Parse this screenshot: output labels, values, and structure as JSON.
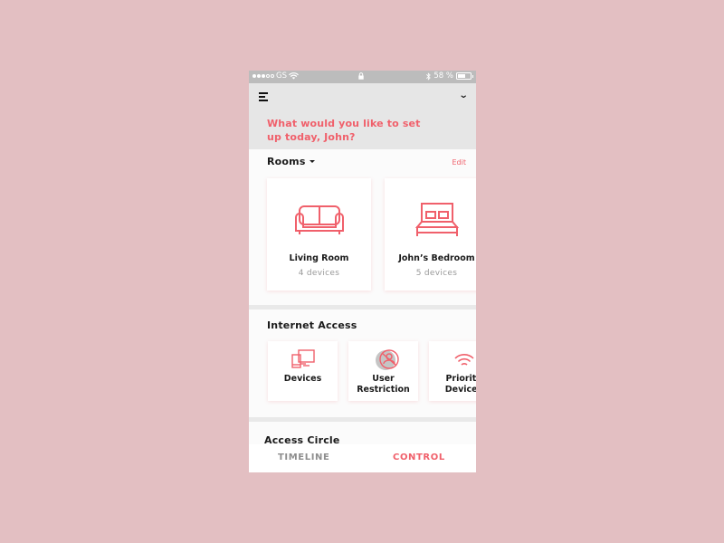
{
  "status_bar": {
    "carrier": "GS",
    "signal_dots_filled": 3,
    "signal_dots_total": 5,
    "battery_percent_label": "58 %",
    "battery_level": 0.58,
    "icons": [
      "wifi-icon",
      "lock-icon",
      "bluetooth-icon",
      "battery-icon"
    ]
  },
  "header": {
    "menu_icon": "menu-icon",
    "dropdown_icon": "chevron-down-icon",
    "greeting": "What would you like to set up today, John?"
  },
  "rooms": {
    "title": "Rooms",
    "edit_label": "Edit",
    "items": [
      {
        "name": "Living Room",
        "count": "4 devices",
        "icon": "sofa-icon"
      },
      {
        "name": "John’s Bedroom",
        "count": "5 devices",
        "icon": "bed-icon"
      }
    ]
  },
  "internet_access": {
    "title": "Internet Access",
    "items": [
      {
        "label_line1": "Devices",
        "label_line2": "",
        "icon": "devices-icon"
      },
      {
        "label_line1": "User",
        "label_line2": "Restriction",
        "icon": "user-restriction-icon"
      },
      {
        "label_line1": "Priority",
        "label_line2": "Devices",
        "icon": "wifi-priority-icon"
      }
    ]
  },
  "access_circle": {
    "title": "Access Circle"
  },
  "tabs": [
    {
      "label": "TIMELINE",
      "active": false
    },
    {
      "label": "CONTROL",
      "active": true
    }
  ],
  "colors": {
    "accent": "#f0606b",
    "background": "#e3bfc2",
    "header_bg": "#e6e6e6",
    "status_bar_bg": "#bcbcbc",
    "inactive_tab": "#8e8e8e"
  }
}
